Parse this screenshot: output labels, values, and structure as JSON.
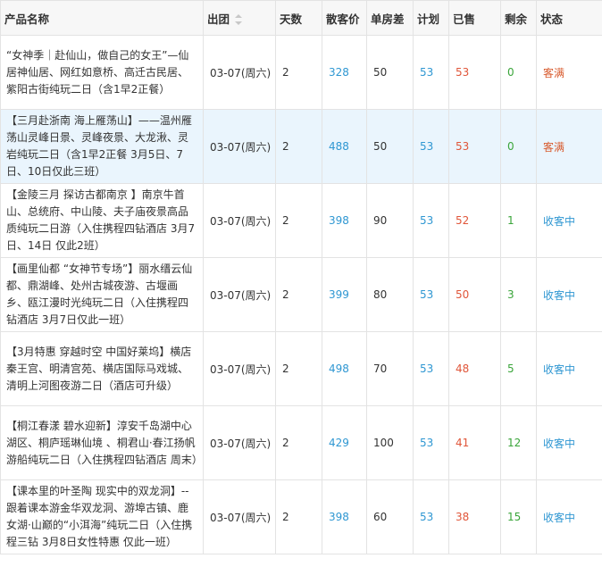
{
  "headers": {
    "name": "产品名称",
    "depart": "出团",
    "days": "天数",
    "price": "散客价",
    "single": "单房差",
    "plan": "计划",
    "sold": "已售",
    "left": "剩余",
    "status": "状态"
  },
  "rows": [
    {
      "name": "“女神季｜赴仙山，做自己的女王”—仙居神仙居、网红如意桥、高迁古民居、紫阳古街纯玩二日（含1早2正餐）",
      "depart": "03-07(周六)",
      "days": "2",
      "price": "328",
      "single": "50",
      "plan": "53",
      "sold": "53",
      "left": "0",
      "status": "客满"
    },
    {
      "name": "【三月赴浙南 海上雁荡山】——温州雁荡山灵峰日景、灵峰夜景、大龙湫、灵岩纯玩二日（含1早2正餐 3月5日、7日、10日仅此三班）",
      "depart": "03-07(周六)",
      "days": "2",
      "price": "488",
      "single": "50",
      "plan": "53",
      "sold": "53",
      "left": "0",
      "status": "客满"
    },
    {
      "name": "【金陵三月 探访古都南京 】南京牛首山、总统府、中山陵、夫子庙夜景高品质纯玩二日游（入住携程四钻酒店 3月7日、14日 仅此2班）",
      "depart": "03-07(周六)",
      "days": "2",
      "price": "398",
      "single": "90",
      "plan": "53",
      "sold": "52",
      "left": "1",
      "status": "收客中"
    },
    {
      "name": "【画里仙都 “女神节专场”】丽水缙云仙都、鼎湖峰、处州古城夜游、古堰画乡、瓯江漫时光纯玩二日（入住携程四钻酒店 3月7日仅此一班）",
      "depart": "03-07(周六)",
      "days": "2",
      "price": "399",
      "single": "80",
      "plan": "53",
      "sold": "50",
      "left": "3",
      "status": "收客中"
    },
    {
      "name": "【3月特惠 穿越时空 中国好莱坞】横店秦王宫、明清宫苑、横店国际马戏城、清明上河图夜游二日（酒店可升级）",
      "depart": "03-07(周六)",
      "days": "2",
      "price": "498",
      "single": "70",
      "plan": "53",
      "sold": "48",
      "left": "5",
      "status": "收客中"
    },
    {
      "name": "【桐江春漾 碧水迎新】淳安千岛湖中心湖区、桐庐瑶琳仙境 、桐君山·春江扬帆游船纯玩二日（入住携程四钻酒店 周末）",
      "depart": "03-07(周六)",
      "days": "2",
      "price": "429",
      "single": "100",
      "plan": "53",
      "sold": "41",
      "left": "12",
      "status": "收客中"
    },
    {
      "name": "【课本里的叶圣陶 现实中的双龙洞】--跟着课本游金华双龙洞、游埠古镇、鹿女湖·山巅的“小洱海”纯玩二日（入住携程三钻 3月8日女性特惠 仅此一班）",
      "depart": "03-07(周六)",
      "days": "2",
      "price": "398",
      "single": "60",
      "plan": "53",
      "sold": "38",
      "left": "15",
      "status": "收客中"
    }
  ]
}
